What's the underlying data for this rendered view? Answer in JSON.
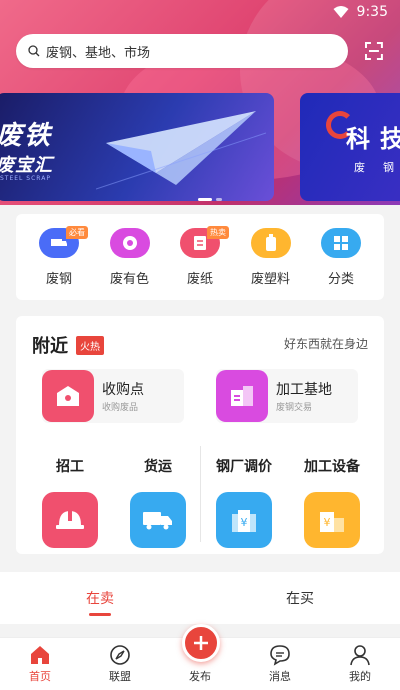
{
  "status": {
    "time": "9:35"
  },
  "search": {
    "placeholder": "废钢、基地、市场"
  },
  "banners": [
    {
      "title": "废铁",
      "subtitle": "废宝汇",
      "caption": "STEEL SCRAP"
    },
    {
      "title": "科技",
      "subtitle": "废钢"
    }
  ],
  "categories": [
    {
      "label": "废钢",
      "icon": "truck-icon",
      "color": "#4a6cf7",
      "tag": "必看"
    },
    {
      "label": "废有色",
      "icon": "coin-icon",
      "color": "#d94be0",
      "tag": ""
    },
    {
      "label": "废纸",
      "icon": "paper-icon",
      "color": "#f0506e",
      "tag": "热卖"
    },
    {
      "label": "废塑料",
      "icon": "bottle-icon",
      "color": "#ffb62f",
      "tag": ""
    },
    {
      "label": "分类",
      "icon": "grid-icon",
      "color": "#37aaf0",
      "tag": ""
    }
  ],
  "nearby": {
    "title": "附近",
    "badge": "火热",
    "right_text": "好东西就在身边",
    "shortcuts": [
      {
        "title": "收购点",
        "sub": "收购废品",
        "color": "#f0506e"
      },
      {
        "title": "加工基地",
        "sub": "废钢交易",
        "color": "#d94be0"
      }
    ],
    "services": [
      {
        "label": "招工",
        "icon": "helmet-icon",
        "color": "#f0506e"
      },
      {
        "label": "货运",
        "icon": "truck-icon",
        "color": "#37aaf0"
      },
      {
        "label": "钢厂调价",
        "icon": "price-icon",
        "color": "#37aaf0"
      },
      {
        "label": "加工设备",
        "icon": "equipment-icon",
        "color": "#ffb62f"
      }
    ]
  },
  "tabs": [
    {
      "label": "在卖",
      "active": true
    },
    {
      "label": "在买",
      "active": false
    }
  ],
  "bottom_nav": [
    {
      "label": "首页",
      "icon": "home-icon",
      "active": true
    },
    {
      "label": "联盟",
      "icon": "compass-icon",
      "active": false
    },
    {
      "label": "发布",
      "icon": "plus-icon",
      "active": false
    },
    {
      "label": "消息",
      "icon": "message-icon",
      "active": false
    },
    {
      "label": "我的",
      "icon": "user-icon",
      "active": false
    }
  ],
  "colors": {
    "accent": "#e8453c"
  }
}
